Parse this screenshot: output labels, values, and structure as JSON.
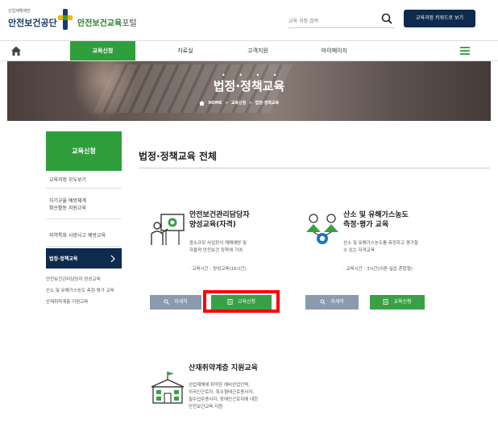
{
  "header": {
    "agency_small": "산업재해예방",
    "agency": "안전보건공단",
    "portal_main": "안전보건교육",
    "portal_sub": "포털",
    "search_placeholder": "교육 과정 검색",
    "keyword_button": "교육과정 키워드로 보기"
  },
  "nav": {
    "items": [
      "교육신청",
      "자료실",
      "고객지원",
      "마이페이지"
    ]
  },
  "banner": {
    "dots": "• • • •",
    "title": "법정·정책교육",
    "breadcrumb": [
      "HOME",
      "교육신청",
      "법정·정책교육"
    ],
    "separator": ">"
  },
  "sidebar": {
    "heading": "교육신청",
    "items": [
      "교육과정 모두보기",
      "자기규율 예방체계 확산활동 지원교육",
      "지역특화 사망사고 예방교육",
      "법정·정책교육"
    ],
    "item_lines": [
      [
        "교육과정 모두보기"
      ],
      [
        "자기규율 예방체계",
        "확산활동 지원교육"
      ],
      [
        "지역특화 사망사고 예방교육"
      ],
      [
        "법정·정책교육"
      ]
    ],
    "subitems": [
      "안전보건관리담당자 양성교육",
      "산소 및 유해가스농도 측정·평가 교육",
      "산재취약계층 지원교육"
    ]
  },
  "main": {
    "title": "법정·정책교육 전체",
    "courses": [
      {
        "title_lines": [
          "안전보건관리담당자",
          "양성교육(자격)"
        ],
        "desc_lines": [
          "중소규모 사업장의 재해예방 및",
          "자율적 안전보건 정착에 기여"
        ],
        "time": "· 교육시간 : 양성교육(16시간)",
        "detail_label": "자세히",
        "apply_label": "교육신청"
      },
      {
        "title_lines": [
          "산소 및 유해가스농도",
          "측정·평가 교육"
        ],
        "desc_lines": [
          "산소 및 유해가스농도를 측정하고 평가할",
          "수 있는 자격교육"
        ],
        "time": "· 교육시간 : 3시간(이론·실습 혼합형)",
        "detail_label": "자세히",
        "apply_label": "교육신청"
      },
      {
        "title_lines": [
          "산재취약계층 지원교육"
        ],
        "desc_lines": [
          "산업재해에 취약한 예비산업인력,",
          "외국인근로자, 특수형태근로종사자,",
          "필수업무종사자, 장애인근로자에 대한",
          "안전보건교육 지원"
        ]
      }
    ]
  },
  "colors": {
    "green": "#2f9f3c",
    "navy": "#0e2a4d",
    "button_grey": "#8a9bb0",
    "highlight": "#ff0000"
  }
}
